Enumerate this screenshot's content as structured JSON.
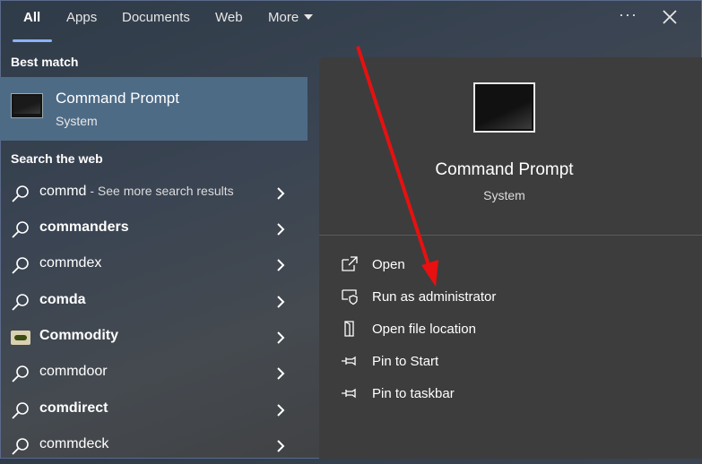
{
  "tabs": [
    {
      "label": "All",
      "active": true
    },
    {
      "label": "Apps"
    },
    {
      "label": "Documents"
    },
    {
      "label": "Web"
    },
    {
      "label": "More"
    }
  ],
  "left": {
    "best_match_heading": "Best match",
    "best_match": {
      "title": "Command Prompt",
      "subtitle": "System",
      "icon": "command-prompt-icon"
    },
    "web_heading": "Search the web",
    "web_results": [
      {
        "query": "commd",
        "suffix": " - See more search results",
        "icon": "search-icon",
        "bold": false
      },
      {
        "query": "commanders",
        "icon": "search-icon",
        "bold": true
      },
      {
        "query": "commdex",
        "icon": "search-icon",
        "bold": false
      },
      {
        "query": "comda",
        "icon": "search-icon",
        "bold": true
      },
      {
        "query": "Commodity",
        "icon": "commodity-thumbnail-icon",
        "bold": true
      },
      {
        "query": "commdoor",
        "icon": "search-icon",
        "bold": false
      },
      {
        "query": "comdirect",
        "icon": "search-icon",
        "bold": true
      },
      {
        "query": "commdeck",
        "icon": "search-icon",
        "bold": false
      }
    ]
  },
  "panel": {
    "title": "Command Prompt",
    "subtitle": "System",
    "actions": [
      {
        "label": "Open",
        "icon": "open-external-icon"
      },
      {
        "label": "Run as administrator",
        "icon": "shield-admin-icon"
      },
      {
        "label": "Open file location",
        "icon": "file-location-icon"
      },
      {
        "label": "Pin to Start",
        "icon": "pin-icon"
      },
      {
        "label": "Pin to taskbar",
        "icon": "pin-icon"
      }
    ]
  },
  "colors": {
    "accent": "#8ab4f8",
    "selection": "#4e6b86",
    "annotation_arrow": "#e81010"
  }
}
